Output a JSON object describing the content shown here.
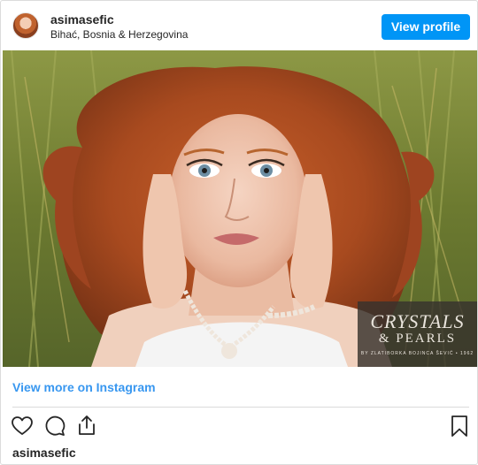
{
  "header": {
    "username": "asimasefic",
    "location": "Bihać, Bosnia & Herzegovina",
    "view_profile_label": "View profile"
  },
  "photo": {
    "alt": "",
    "watermark": {
      "line1": "CRYSTALS",
      "line2": "& PEARLS",
      "line3": "BY ZLATIBORKA BOJINCA ŠEVIĆ • 1962"
    }
  },
  "links": {
    "view_more_label": "View more on Instagram"
  },
  "actions": {
    "icons": [
      "heart-icon",
      "comment-icon",
      "share-icon",
      "bookmark-icon"
    ]
  },
  "footer": {
    "username": "asimasefic"
  },
  "colors": {
    "accent": "#0095f6",
    "link": "#3897f0",
    "text": "#262626",
    "border": "#dbdbdb"
  }
}
